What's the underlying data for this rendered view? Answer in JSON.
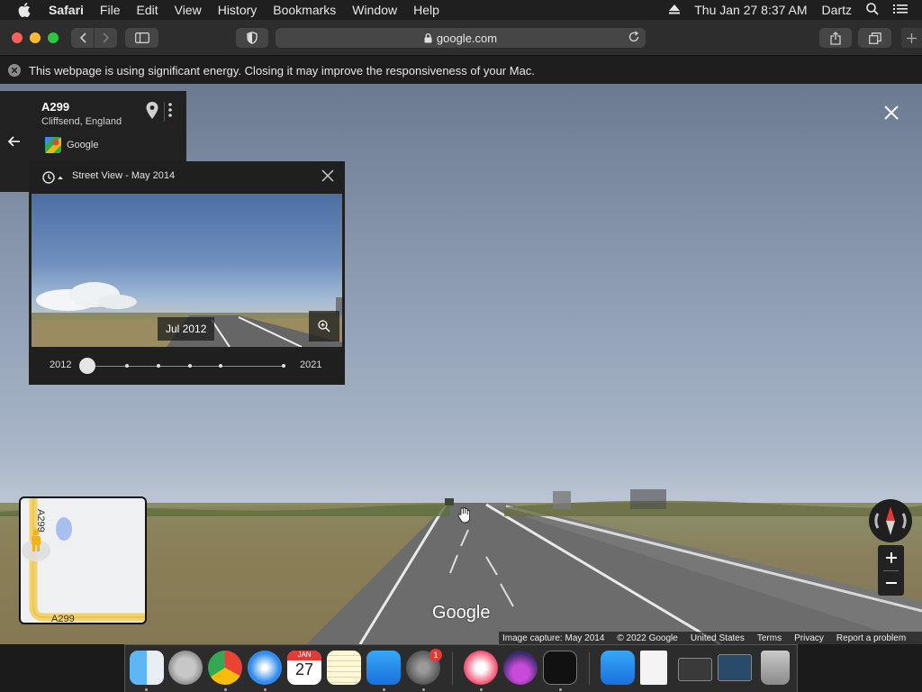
{
  "menubar": {
    "app_name": "Safari",
    "items": [
      "File",
      "Edit",
      "View",
      "History",
      "Bookmarks",
      "Window",
      "Help"
    ],
    "clock": "Thu Jan 27  8:37 AM",
    "user": "Dartz"
  },
  "toolbar": {
    "url": "google.com"
  },
  "notice": {
    "text": "This webpage is using significant energy. Closing it may improve the responsiveness of your Mac."
  },
  "place_card": {
    "title": "A299",
    "subtitle": "Cliffsend, England",
    "source": "Google"
  },
  "time_machine": {
    "label": "Street View - May 2014",
    "preview_date": "Jul 2012",
    "start_year": "2012",
    "end_year": "2021"
  },
  "minimap": {
    "road_label_vertical": "A299",
    "road_label_bottom": "A299"
  },
  "watermark": "Google",
  "footer": {
    "capture": "Image capture: May 2014",
    "copyright": "© 2022 Google",
    "region": "United States",
    "terms": "Terms",
    "privacy": "Privacy",
    "report": "Report a problem"
  },
  "dock": {
    "calendar_month": "JAN",
    "calendar_day": "27",
    "settings_badge": "1"
  },
  "colors": {
    "menubar_bg": "#1f1f1f",
    "toolbar_bg": "#2d2d2d",
    "close_red": "#ff5f57",
    "minimize_yellow": "#febc2e",
    "zoom_green": "#28c840"
  }
}
